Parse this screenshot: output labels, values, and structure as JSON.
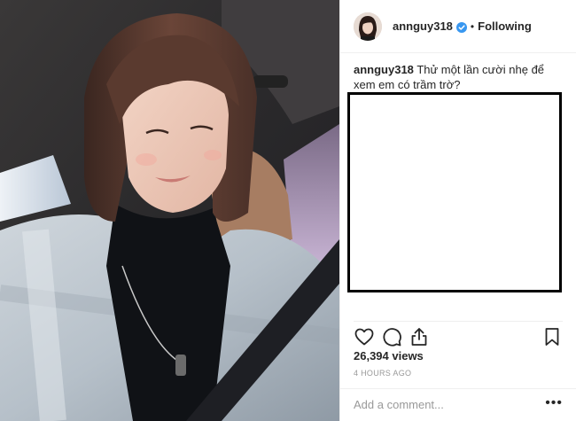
{
  "post": {
    "username": "annguy318",
    "follow_separator": "•",
    "follow_status": "Following",
    "caption_user": "annguy318",
    "caption_text": "Thử một lần cười nhẹ để xem em có trầm trờ?",
    "views": "26,394 views",
    "timestamp": "4 HOURS AGO",
    "comment_placeholder": "Add a comment...",
    "more_label": "•••"
  },
  "icons": {
    "like": "heart-outline-icon",
    "comment": "speech-bubble-icon",
    "share": "share-upload-icon",
    "save": "bookmark-icon",
    "verified": "verified-badge-icon"
  },
  "colors": {
    "verified": "#3897f0",
    "text": "#262626",
    "muted": "#999999",
    "border": "#efefef"
  }
}
